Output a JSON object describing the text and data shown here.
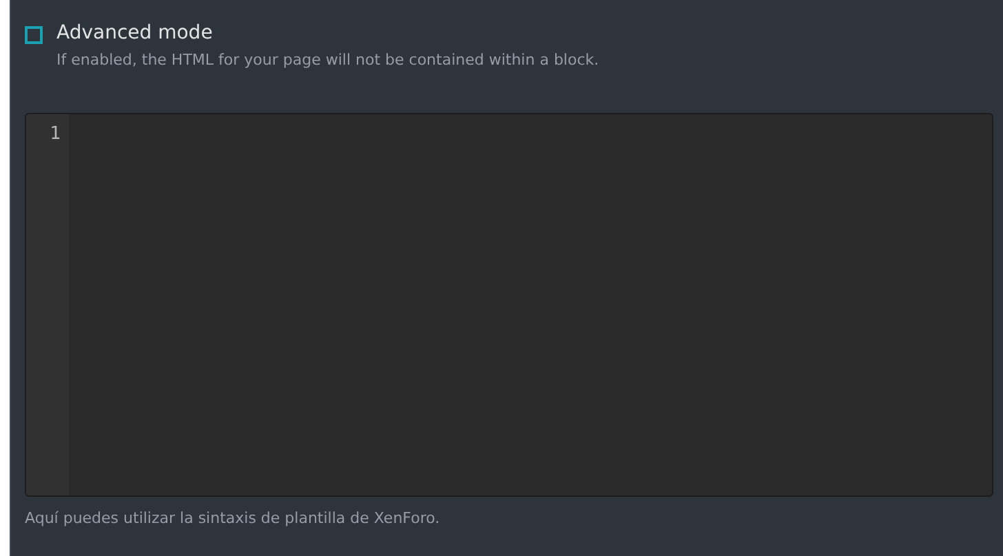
{
  "advanced_mode": {
    "label": "Advanced mode",
    "checked": false,
    "hint": "If enabled, the HTML for your page will not be contained within a block."
  },
  "code_editor": {
    "line_numbers": [
      "1"
    ]
  },
  "editor_hint": "Aquí puedes utilizar la sintaxis de plantilla de XenForo."
}
